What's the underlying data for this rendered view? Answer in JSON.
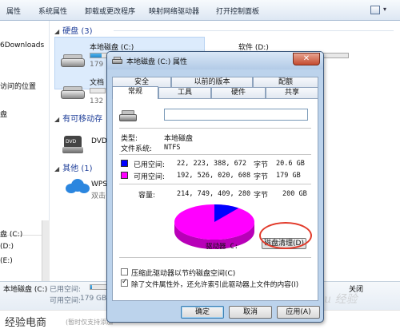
{
  "toolbar": {
    "items": [
      "属性",
      "系统属性",
      "卸载或更改程序",
      "映射网络驱动器",
      "打开控制面板"
    ]
  },
  "nav": {
    "items": [
      "6Downloads",
      "访问的位置",
      "盘",
      "盘 (C:)",
      "(D:)",
      "(E:)"
    ]
  },
  "content": {
    "group_hdd": "硬盘 (3)",
    "group_removable": "有可移动存",
    "group_other": "其他 (1)",
    "drive_c_name": "本地磁盘 (C:)",
    "drive_c_free": "179",
    "drive_c_used_fraction": 0.1,
    "drive_d_name": "软件 (D:)",
    "drive_d_used_fraction": 0.0,
    "drive_e_name": "文档",
    "drive_e_free": "132",
    "drive_e_used_fraction": 0.0,
    "dvd_label": "DVD",
    "wps_name": "WPS",
    "wps_desc": "双击"
  },
  "details": {
    "name": "本地磁盘 (C:)",
    "used_label": "已用空间:",
    "free_label": "可用空间:",
    "free_value": "179 GB",
    "used_fraction": 0.1,
    "right_text": "关闭"
  },
  "banner": {
    "title": "经验电商",
    "note": "(暂时仅支持添加"
  },
  "watermark": {
    "text": "Baidu 经验"
  },
  "dialog": {
    "title": "本地磁盘 (C:) 属性",
    "close": "✕",
    "tabs_row1": [
      "安全",
      "以前的版本",
      "配额"
    ],
    "tabs_row2": [
      "常规",
      "工具",
      "硬件",
      "共享"
    ],
    "active_tab": "常规",
    "name_value": "",
    "type_label": "类型:",
    "type_value": "本地磁盘",
    "fs_label": "文件系统:",
    "fs_value": "NTFS",
    "used_label": "已用空间:",
    "used_bytes": "22, 223, 388, 672",
    "used_unit": "字节",
    "used_gb": "20.6 GB",
    "free_label": "可用空间:",
    "free_bytes": "192, 526, 020, 608",
    "free_unit": "字节",
    "free_gb": "179 GB",
    "cap_label": "容量:",
    "cap_bytes": "214, 749, 409, 280",
    "cap_unit": "字节",
    "cap_gb": "200 GB",
    "drive_label": "驱动器 C:",
    "cleanup_button": "磁盘清理(D)",
    "compress_label": "压缩此驱动器以节约磁盘空间(C)",
    "compress_checked": false,
    "index_label": "除了文件属性外，还允许索引此驱动器上文件的内容(I)",
    "index_checked": true,
    "ok": "确定",
    "cancel": "取消",
    "apply": "应用(A)",
    "used_color": "#0000ff",
    "free_color": "#ff00ff",
    "used_fraction": 0.1035
  }
}
